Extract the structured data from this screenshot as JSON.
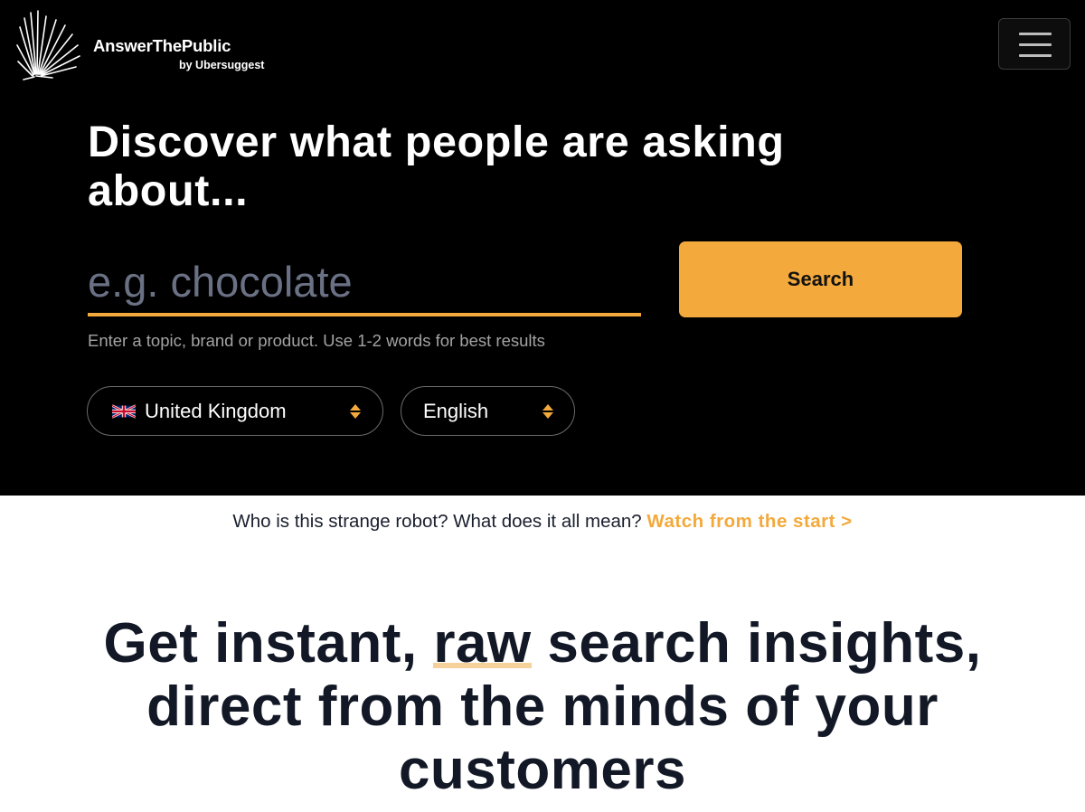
{
  "brand": {
    "name": "AnswerThePublic",
    "byline": "by Ubersuggest"
  },
  "colors": {
    "accent": "#f3a93b",
    "hero_bg": "#000000",
    "text_dark": "#121826"
  },
  "header": {
    "menu_icon": "hamburger-menu-icon"
  },
  "hero": {
    "headline": "Discover what people are asking about...",
    "search": {
      "value": "",
      "placeholder": "e.g. chocolate",
      "button_label": "Search",
      "hint": "Enter a topic, brand or product. Use 1-2 words for best results"
    },
    "country_select": {
      "flag_icon": "uk-flag-icon",
      "selected": "United Kingdom"
    },
    "language_select": {
      "selected": "English"
    }
  },
  "info": {
    "question": "Who is this strange robot? What does it all mean?",
    "link": "Watch from the start >"
  },
  "tagline": {
    "part1": "Get instant,",
    "highlight": "raw",
    "part2": "search insights, direct from the minds of your customers"
  }
}
